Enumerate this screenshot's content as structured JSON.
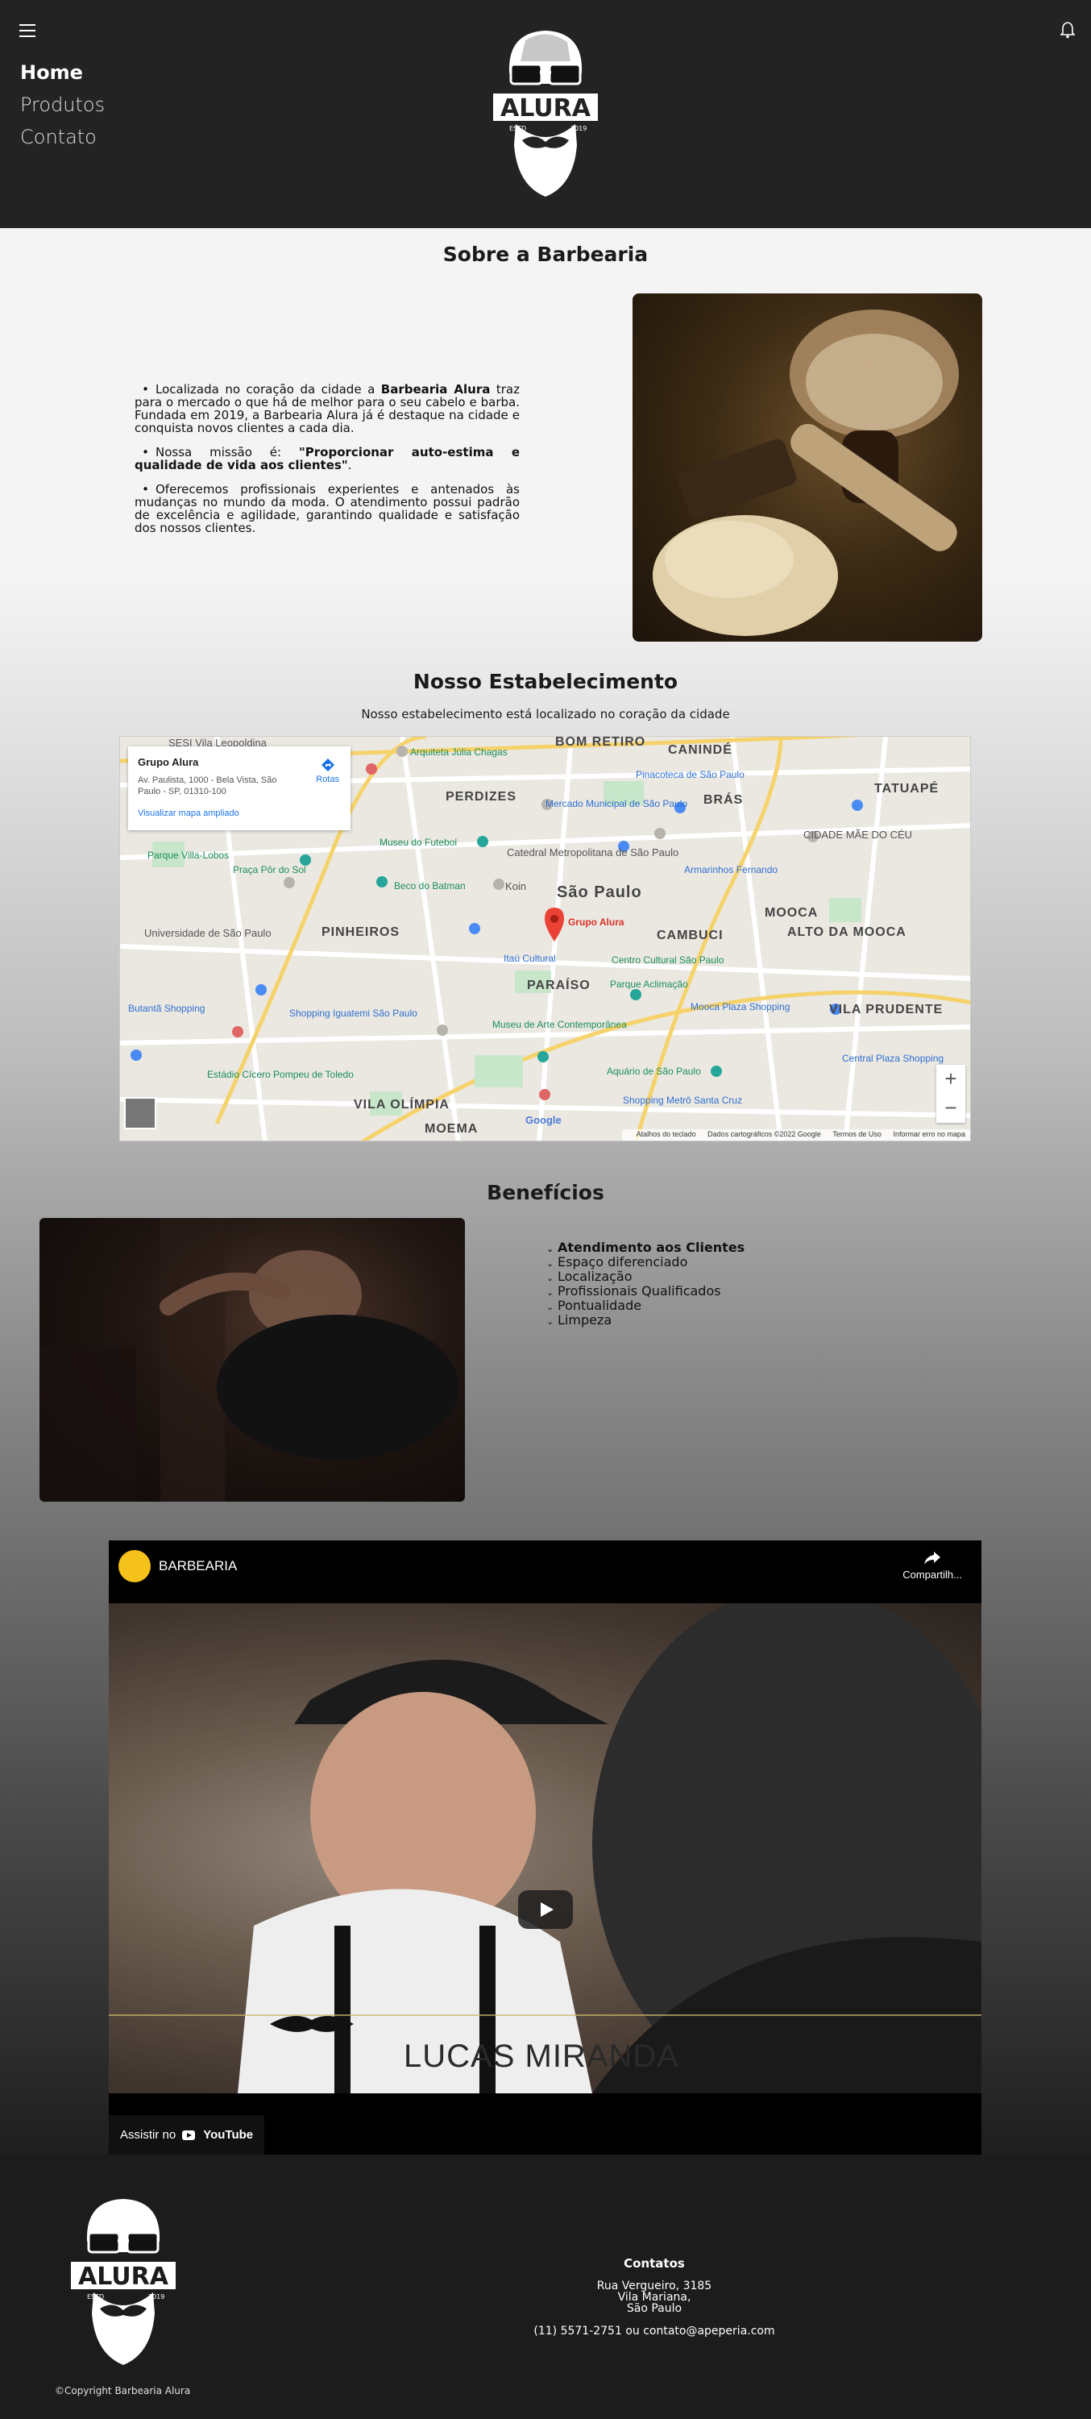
{
  "header": {
    "nav": [
      "Home",
      "Produtos",
      "Contato"
    ],
    "logo_text": "ALURA",
    "logo_left": "ESTD",
    "logo_right": "2019"
  },
  "about": {
    "title": "Sobre a Barbearia",
    "p1_pre": "Localizada no coração da cidade a ",
    "p1_bold": "Barbearia Alura",
    "p1_post": " traz para o mercado o que há de melhor para o seu cabelo e barba. Fundada em 2019, a Barbearia Alura já é destaque na cidade e conquista novos clientes a cada dia.",
    "p2_pre": "Nossa missão é: ",
    "p2_bold": "\"Proporcionar auto-estima e qualidade de vida aos clientes\"",
    "p2_post": ".",
    "p3": "Oferecemos profissionais experientes e antenados às mudanças no mundo da moda. O atendimento possui padrão de excelência e agilidade, garantindo qualidade e satisfação dos nossos clientes."
  },
  "establishment": {
    "title": "Nosso Estabelecimento",
    "subtitle": "Nosso estabelecimento está localizado no coração da cidade",
    "map": {
      "place_name": "Grupo Alura",
      "address": "Av. Paulista, 1000 - Bela Vista, São Paulo - SP, 01310-100",
      "enlarge_link": "Visualizar mapa ampliado",
      "routes": "Rotas",
      "pin_label": "Grupo Alura",
      "footer_shortcuts": "Atalhos do teclado",
      "footer_data": "Dados cartográficos ©2022 Google",
      "footer_terms": "Termos de Uso",
      "footer_report": "Informar erro no mapa",
      "google": "Google",
      "labels": {
        "l1": "São Paulo",
        "l2": "PINHEIROS",
        "l3": "PERDIZES",
        "l4": "BOM RETIRO",
        "l5": "CANINDÉ",
        "l6": "BRÁS",
        "l7": "TATUAPÉ",
        "l8": "MOOCA",
        "l9": "CAMBUCI",
        "l10": "PARAÍSO",
        "l11": "VILA OLÍMPIA",
        "l12": "MOEMA",
        "l13": "ALTO DA MOOCA",
        "l14": "VILA PRUDENTE",
        "l15": "CIDADE MÃE DO CÉU",
        "p1": "Arquiteta Júlia Chagas",
        "p2": "Pinacoteca de São Paulo",
        "p3": "Mercado Municipal de São Paulo",
        "p4": "Museu do Futebol",
        "p5": "Catedral Metropolitana de São Paulo",
        "p6": "Beco do Batman",
        "p7": "Praça Pôr do Sol",
        "p8": "Parque Villa-Lobos",
        "p9": "Universidade de São Paulo",
        "p10": "Itaú Cultural",
        "p11": "Centro Cultural São Paulo",
        "p12": "Parque Aclimação",
        "p13": "Mooca Plaza Shopping",
        "p14": "Shopping Iguatemi São Paulo",
        "p15": "Museu de Arte Contemporânea",
        "p16": "Aquário de São Paulo",
        "p17": "Estádio Cícero Pompeu de Toledo",
        "p18": "Butantã Shopping",
        "p19": "Armarinhos Fernando",
        "p20": "Central Plaza Shopping",
        "p21": "Koin",
        "p22": "Shopping Metrô Santa Cruz"
      }
    }
  },
  "benefits": {
    "title": "Benefícios",
    "items": [
      "Atendimento aos Clientes",
      "Espaço diferenciado",
      "Localização",
      "Profissionais Qualificados",
      "Pontualidade",
      "Limpeza"
    ]
  },
  "video": {
    "channel": "BARBEARIA",
    "share": "Compartilh...",
    "caption": "LUCAS MIRANDA",
    "watch_on": "Assistir no",
    "youtube": "YouTube"
  },
  "footer": {
    "copyright": "©Copyright Barbearia Alura",
    "contacts_title": "Contatos",
    "address1": "Rua Vergueiro, 3185",
    "address2": "Vila Mariana,",
    "address3": "São Paulo",
    "phone": "(11) 5571-2751 ou contato@apeperia.com"
  },
  "colors": {
    "header_bg": "#232323",
    "footer_bg": "#1c1c1c",
    "map_link": "#1a73e8",
    "map_pin": "#ea4335"
  }
}
